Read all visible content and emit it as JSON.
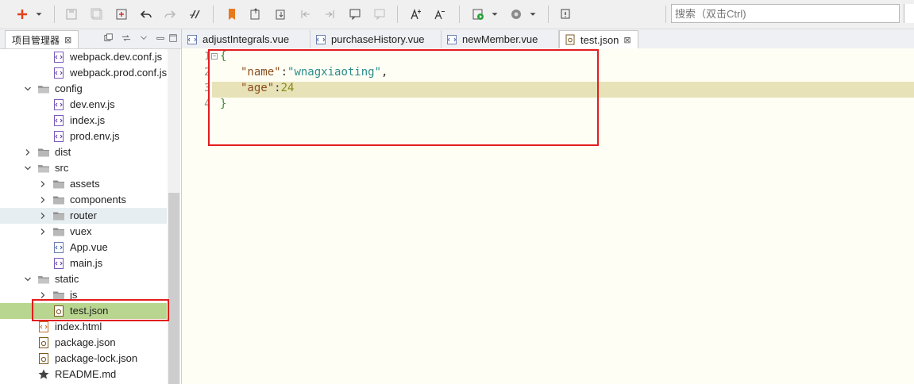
{
  "search": {
    "placeholder": "搜索（双击Ctrl)"
  },
  "left_panel": {
    "tab_label": "项目管理器"
  },
  "tree": [
    {
      "label": "webpack.dev.conf.js",
      "type": "jsfile"
    },
    {
      "label": "webpack.prod.conf.js",
      "type": "jsfile"
    },
    {
      "label": "config",
      "type": "folder-open"
    },
    {
      "label": "dev.env.js",
      "type": "jsfile"
    },
    {
      "label": "index.js",
      "type": "jsfile"
    },
    {
      "label": "prod.env.js",
      "type": "jsfile"
    },
    {
      "label": "dist",
      "type": "folder-closed"
    },
    {
      "label": "src",
      "type": "folder-open"
    },
    {
      "label": "assets",
      "type": "folder-closed"
    },
    {
      "label": "components",
      "type": "folder-closed"
    },
    {
      "label": "router",
      "type": "folder-closed"
    },
    {
      "label": "vuex",
      "type": "folder-closed"
    },
    {
      "label": "App.vue",
      "type": "vuefile"
    },
    {
      "label": "main.js",
      "type": "jsfile"
    },
    {
      "label": "static",
      "type": "folder-open"
    },
    {
      "label": "js",
      "type": "folder-closed"
    },
    {
      "label": "test.json",
      "type": "jsonfile"
    },
    {
      "label": "index.html",
      "type": "htmlfile"
    },
    {
      "label": "package.json",
      "type": "jsonfile"
    },
    {
      "label": "package-lock.json",
      "type": "jsonfile"
    },
    {
      "label": "README.md",
      "type": "mdfile"
    }
  ],
  "editor_tabs": [
    {
      "label": "adjustIntegrals.vue"
    },
    {
      "label": "purchaseHistory.vue"
    },
    {
      "label": "newMember.vue"
    },
    {
      "label": "test.json"
    }
  ],
  "code": {
    "line_numbers": [
      "1",
      "2",
      "3",
      "4"
    ],
    "l1_open": "{",
    "l2_key": "\"name\"",
    "l2_colon": ":",
    "l2_value": "\"wnagxiaoting\"",
    "l2_comma": ",",
    "l3_key": "\"age\"",
    "l3_colon": ":",
    "l3_value": "24",
    "l4_close": "}"
  },
  "colors": {
    "selected_row": "#b9d690",
    "highlight_box": "#e21d1d",
    "editor_bg": "#fffef4",
    "current_line": "#e8e2b8"
  }
}
